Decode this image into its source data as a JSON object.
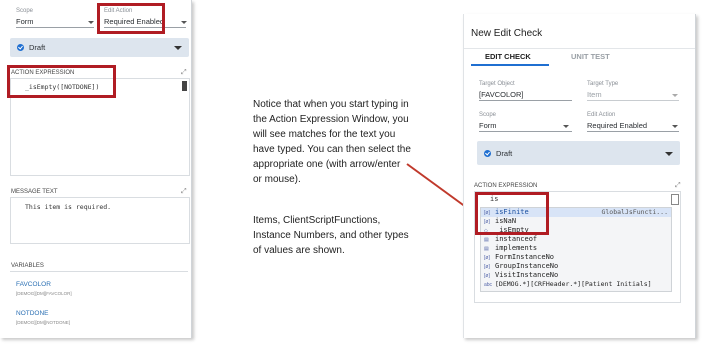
{
  "left": {
    "scope": {
      "label": "Scope",
      "value": "Form"
    },
    "edit_action": {
      "label": "Edit Action",
      "value": "Required Enabled"
    },
    "status": "Draft",
    "action_expression": {
      "label": "ACTION EXPRESSION",
      "code": "_isEmpty([NOTDONE])"
    },
    "message_text": {
      "label": "MESSAGE TEXT",
      "code": "This item is required."
    },
    "variables": {
      "label": "VARIABLES",
      "items": [
        {
          "name": "FAVCOLOR",
          "path": "[DEMOG][DM][FAVCOLOR]"
        },
        {
          "name": "NOTDONE",
          "path": "[DEMOG][DM][NOTDONE]"
        }
      ]
    }
  },
  "note": {
    "paragraph1": "Notice that when you start typing in the Action Expression Window, you will see matches for the text you have typed. You can then select the appropriate one (with arrow/enter or mouse).",
    "paragraph2": "Items, ClientScriptFunctions, Instance Numbers, and other types of values are shown."
  },
  "right": {
    "title": "New Edit Check",
    "tabs": [
      "EDIT CHECK",
      "UNIT TEST"
    ],
    "target_object": {
      "label": "Target Object",
      "value": "[FAVCOLOR]"
    },
    "target_type": {
      "label": "Target Type",
      "value": "Item"
    },
    "scope": {
      "label": "Scope",
      "value": "Form"
    },
    "edit_action": {
      "label": "Edit Action",
      "value": "Required Enabled"
    },
    "status": "Draft",
    "action_expression": {
      "label": "ACTION EXPRESSION",
      "typed": "is"
    },
    "suggestions": [
      {
        "tag": "[ø]",
        "text": "isFinite",
        "detail": "GlobalJsFuncti..."
      },
      {
        "tag": "[ø]",
        "text": "isNaN",
        "detail": ""
      },
      {
        "tag": "◇",
        "text": "_isEmpty",
        "detail": ""
      },
      {
        "tag": "▤",
        "text": "instanceof",
        "detail": ""
      },
      {
        "tag": "▤",
        "text": "implements",
        "detail": ""
      },
      {
        "tag": "[ø]",
        "text": "FormInstanceNo",
        "detail": ""
      },
      {
        "tag": "[ø]",
        "text": "GroupInstanceNo",
        "detail": ""
      },
      {
        "tag": "[ø]",
        "text": "VisitInstanceNo",
        "detail": ""
      },
      {
        "tag": "abc",
        "text": "[DEMOG.*][CRFHeader.*][Patient Initials]",
        "detail": ""
      }
    ]
  },
  "colors": {
    "highlight_box": "#b01c23",
    "accent": "#1f6fd1",
    "draft_bg": "#dde5ee",
    "arrow": "#c0392b"
  }
}
